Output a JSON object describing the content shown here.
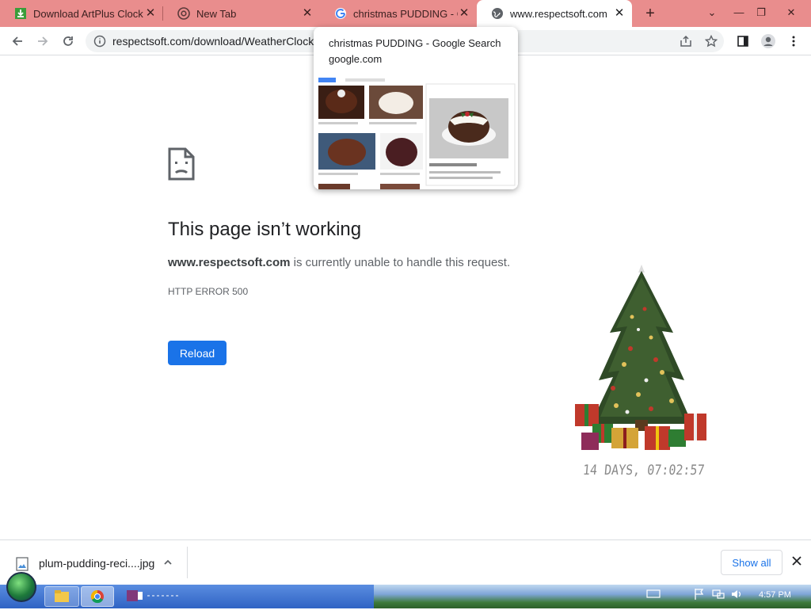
{
  "tabs": [
    {
      "title": "Download ArtPlus Clock",
      "icon": "download-icon",
      "active": false
    },
    {
      "title": "New Tab",
      "icon": "chrome-icon",
      "active": false
    },
    {
      "title": "christmas PUDDING - Goo",
      "icon": "google-icon",
      "active": false
    },
    {
      "title": "www.respectsoft.com",
      "icon": "globe-icon",
      "active": true
    }
  ],
  "address_bar": {
    "url": "respectsoft.com/download/WeatherClock"
  },
  "hover_card": {
    "title": "christmas PUDDING - Google Search",
    "domain": "google.com"
  },
  "error_page": {
    "title": "This page isn’t working",
    "host": "www.respectsoft.com",
    "message": " is currently unable to handle this request.",
    "code": "HTTP ERROR 500",
    "reload_label": "Reload"
  },
  "widget": {
    "countdown": "14 DAYS, 07:02:57"
  },
  "download_bar": {
    "filename": "plum-pudding-reci....jpg",
    "show_all_label": "Show all"
  },
  "taskbar": {
    "clock": "4:57 PM"
  },
  "colors": {
    "tabstrip": "#e98d8d",
    "accent": "#1a73e8"
  }
}
